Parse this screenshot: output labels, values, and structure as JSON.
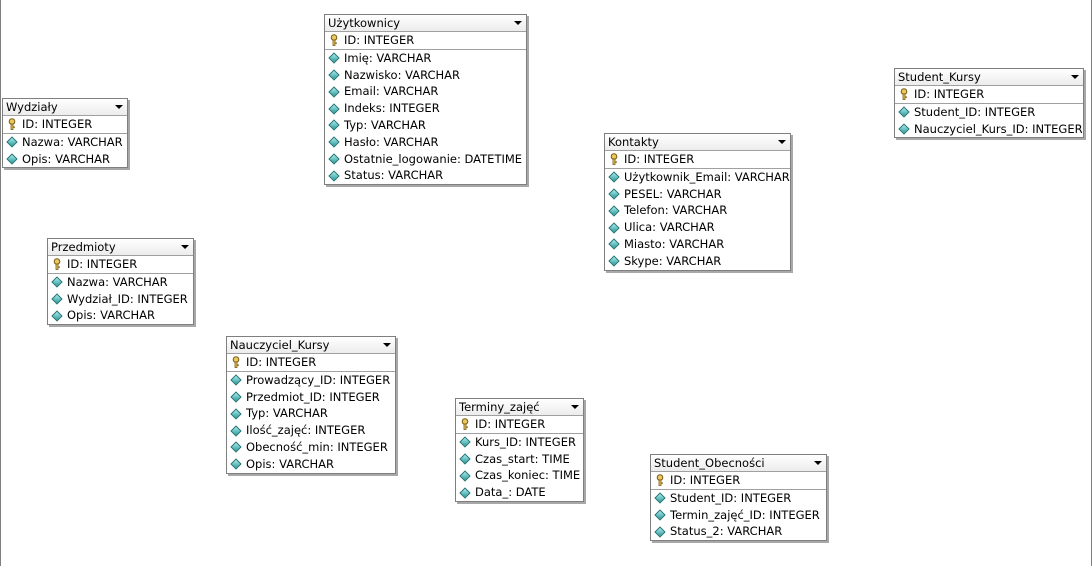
{
  "diagram": {
    "tables": [
      {
        "name": "Wydziały",
        "pk": "ID: INTEGER",
        "columns": [
          "Nazwa: VARCHAR",
          "Opis: VARCHAR"
        ]
      },
      {
        "name": "Użytkownicy",
        "pk": "ID: INTEGER",
        "columns": [
          "Imię: VARCHAR",
          "Nazwisko: VARCHAR",
          "Email: VARCHAR",
          "Indeks: INTEGER",
          "Typ: VARCHAR",
          "Hasło: VARCHAR",
          "Ostatnie_logowanie: DATETIME",
          "Status: VARCHAR"
        ]
      },
      {
        "name": "Student_Kursy",
        "pk": "ID: INTEGER",
        "columns": [
          "Student_ID: INTEGER",
          "Nauczyciel_Kurs_ID: INTEGER"
        ]
      },
      {
        "name": "Kontakty",
        "pk": "ID: INTEGER",
        "columns": [
          "Użytkownik_Email: VARCHAR",
          "PESEL: VARCHAR",
          "Telefon: VARCHAR",
          "Ulica: VARCHAR",
          "Miasto: VARCHAR",
          "Skype: VARCHAR"
        ]
      },
      {
        "name": "Przedmioty",
        "pk": "ID: INTEGER",
        "columns": [
          "Nazwa: VARCHAR",
          "Wydział_ID: INTEGER",
          "Opis: VARCHAR"
        ]
      },
      {
        "name": "Nauczyciel_Kursy",
        "pk": "ID: INTEGER",
        "columns": [
          "Prowadzący_ID: INTEGER",
          "Przedmiot_ID: INTEGER",
          "Typ: VARCHAR",
          "Ilość_zajęć: INTEGER",
          "Obecność_min: INTEGER",
          "Opis: VARCHAR"
        ]
      },
      {
        "name": "Terminy_zajęć",
        "pk": "ID: INTEGER",
        "columns": [
          "Kurs_ID: INTEGER",
          "Czas_start: TIME",
          "Czas_koniec: TIME",
          "Data_: DATE"
        ]
      },
      {
        "name": "Student_Obecności",
        "pk": "ID: INTEGER",
        "columns": [
          "Student_ID: INTEGER",
          "Termin_zajęć_ID: INTEGER",
          "Status_2: VARCHAR"
        ]
      }
    ]
  }
}
